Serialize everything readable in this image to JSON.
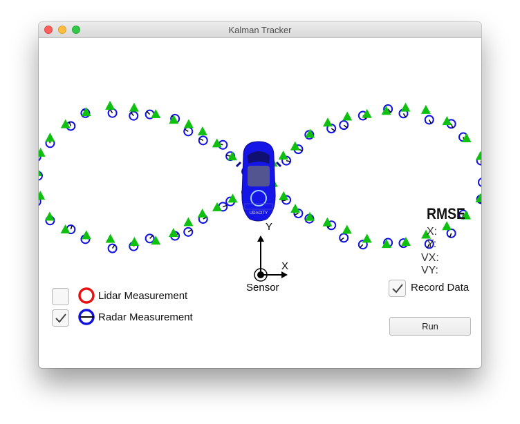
{
  "window": {
    "title": "Kalman Tracker"
  },
  "sensor": {
    "label": "Sensor",
    "x_axis": "X",
    "y_axis": "Y"
  },
  "car": {
    "logo_text": "UDACITY"
  },
  "legend": {
    "lidar_label": "Lidar Measurement",
    "lidar_checked": false,
    "lidar_color": "#e81010",
    "radar_label": "Radar Measurement",
    "radar_checked": true,
    "radar_color": "#1010e0"
  },
  "rmse": {
    "title": "RMSE",
    "x_label": "X:",
    "y_label": "Y:",
    "vx_label": "VX:",
    "vy_label": "VY:"
  },
  "controls": {
    "record_label": "Record Data",
    "record_checked": true,
    "run_label": "Run"
  },
  "colors": {
    "estimate": "#10c010",
    "radar": "#1010e0",
    "car_body": "#1515e8"
  }
}
